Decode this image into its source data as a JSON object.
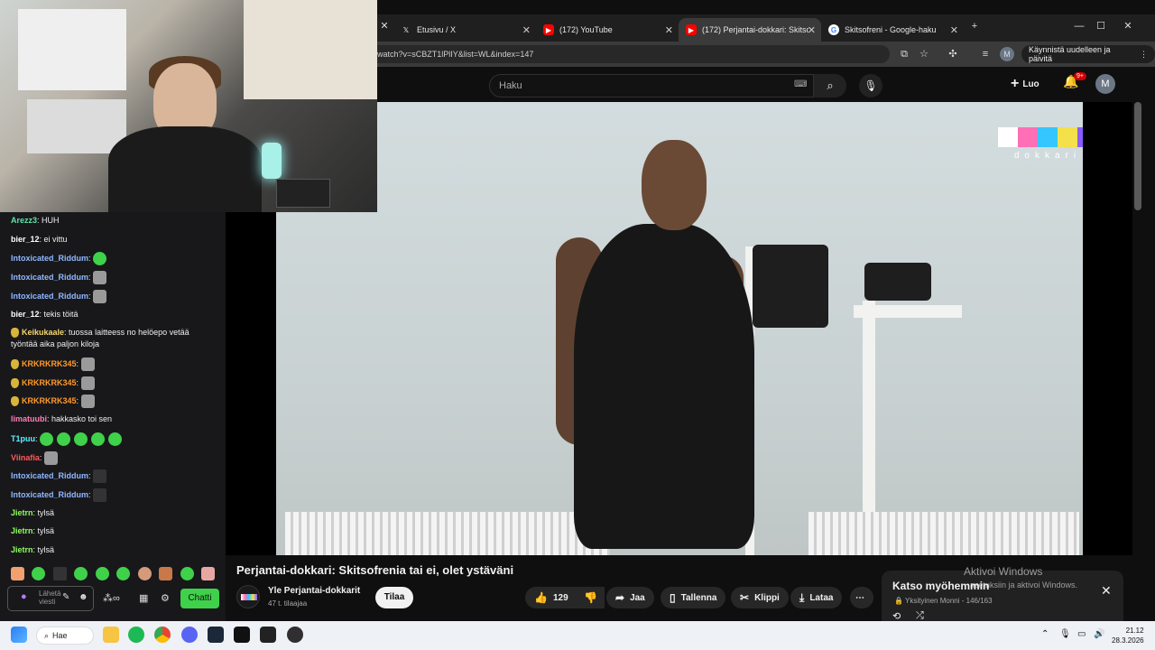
{
  "browser": {
    "tabs": [
      {
        "label": "Etusivu / X",
        "icon": "x-logo-icon"
      },
      {
        "label": "(172) YouTube",
        "icon": "youtube-icon"
      },
      {
        "label": "(172) Perjantai-dokkari: Skitsofr",
        "icon": "youtube-icon",
        "active": true
      },
      {
        "label": "Skitsofreni - Google-haku",
        "icon": "google-icon"
      }
    ],
    "url": "watch?v=sCBZT1lPlIY&list=WL&index=147",
    "restart_label": "Käynnistä uudelleen ja päivitä",
    "profile_initial": "M"
  },
  "youtube": {
    "search_placeholder": "Haku",
    "create_label": "Luo",
    "notifications": "9+",
    "avatar_initial": "M"
  },
  "video": {
    "logo_sub": "dokkari",
    "title": "Perjantai-dokkari: Skitsofrenia tai ei, olet ystäväni",
    "channel_name": "Yle Perjantai-dokkarit",
    "channel_subs": "47 t. tilaajaa",
    "subscribe_label": "Tilaa",
    "likes": "129",
    "share_label": "Jaa",
    "save_label": "Tallenna",
    "clip_label": "Klippi",
    "download_label": "Lataa"
  },
  "watch_later": {
    "title": "Katso myöhemmin",
    "subtitle": "Yksityinen Monni - 146/163"
  },
  "windows_activation": {
    "line1": "Aktivoi Windows",
    "line2": "asetuksiin ja aktivoi Windows."
  },
  "chat": {
    "messages": [
      {
        "user": "Arezz3",
        "text": "HUH",
        "color": "#5ee6a8"
      },
      {
        "user": "bier_12",
        "text": "ei vittu",
        "color": "#ffffff"
      },
      {
        "user": "Intoxicated_Riddum",
        "text": "",
        "color": "#8fb8ff"
      },
      {
        "user": "Intoxicated_Riddum",
        "text": "",
        "color": "#8fb8ff"
      },
      {
        "user": "Intoxicated_Riddum",
        "text": "",
        "color": "#8fb8ff"
      },
      {
        "user": "bier_12",
        "text": "tekis töitä",
        "color": "#ffffff"
      },
      {
        "user": "Keikukaale",
        "text": "tuossa laitteess no helöepo vetää",
        "cont": "työntää aika paljon kiloja",
        "color": "#f5d76e"
      },
      {
        "user": "KRKRKRK345",
        "text": "",
        "color": "#ff9a2a"
      },
      {
        "user": "KRKRKRK345",
        "text": "",
        "color": "#ff9a2a"
      },
      {
        "user": "KRKRKRK345",
        "text": "",
        "color": "#ff9a2a"
      },
      {
        "user": "limatuubi",
        "text": "hakkasko toi sen",
        "color": "#ff7eb6"
      },
      {
        "user": "T1puu",
        "text": "",
        "color": "#5ef0ff"
      },
      {
        "user": "Viinafia",
        "text": "",
        "color": "#ff5a5a"
      },
      {
        "user": "Intoxicated_Riddum",
        "text": "",
        "color": "#8fb8ff"
      },
      {
        "user": "Intoxicated_Riddum",
        "text": "",
        "color": "#8fb8ff"
      },
      {
        "user": "Jietrn",
        "text": "tylsä",
        "color": "#8dff5a"
      },
      {
        "user": "Jietrn",
        "text": "tylsä",
        "color": "#8dff5a"
      },
      {
        "user": "Jietrn",
        "text": "tylsä",
        "color": "#8dff5a"
      }
    ],
    "input_placeholder_1": "Lähetä",
    "input_placeholder_2": "viesti",
    "send_label": "Chatti"
  },
  "taskbar": {
    "search_label": "Hae",
    "time": "21.12",
    "date": "28.3.2026"
  }
}
